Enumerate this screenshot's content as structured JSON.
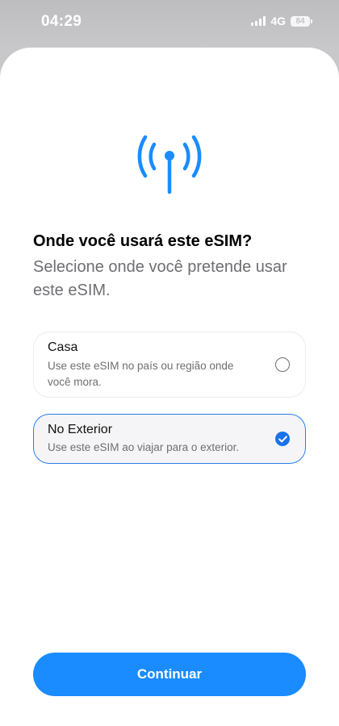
{
  "status_bar": {
    "time": "04:29",
    "network": "4G",
    "battery": "84"
  },
  "header": {
    "icon": "antenna-signal-icon",
    "title": "Onde você usará este eSIM?",
    "subtitle": "Selecione onde você pretende usar este eSIM."
  },
  "options": [
    {
      "title": "Casa",
      "description": "Use este eSIM no país ou região onde você mora.",
      "selected": false
    },
    {
      "title": "No Exterior",
      "description": "Use este eSIM ao viajar para o exterior.",
      "selected": true
    }
  ],
  "actions": {
    "continue_label": "Continuar"
  },
  "colors": {
    "accent": "#1a8cff",
    "selected_border": "#2b7fe6",
    "secondary_text": "#6e6e73"
  }
}
